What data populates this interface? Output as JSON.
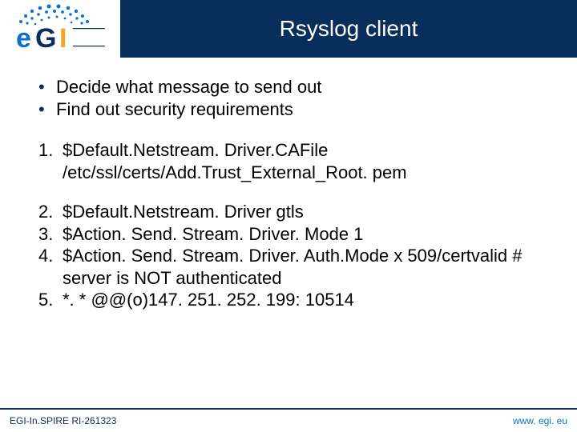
{
  "header": {
    "title": "Rsyslog client",
    "logo_text": "eGI"
  },
  "bullets": [
    "Decide what message to send out",
    "Find out security requirements"
  ],
  "numbered": [
    "$Default.Netstream. Driver.CAFile /etc/ssl/certs/Add.Trust_External_Root. pem",
    "$Default.Netstream. Driver gtls",
    "$Action. Send. Stream. Driver. Mode 1",
    "$Action. Send. Stream. Driver. Auth.Mode x 509/certvalid # server is NOT authenticated",
    "*. * @@(o)147. 251. 252. 199: 10514"
  ],
  "footer": {
    "left": "EGI-In.SPIRE RI-261323",
    "right": "www. egi. eu"
  }
}
